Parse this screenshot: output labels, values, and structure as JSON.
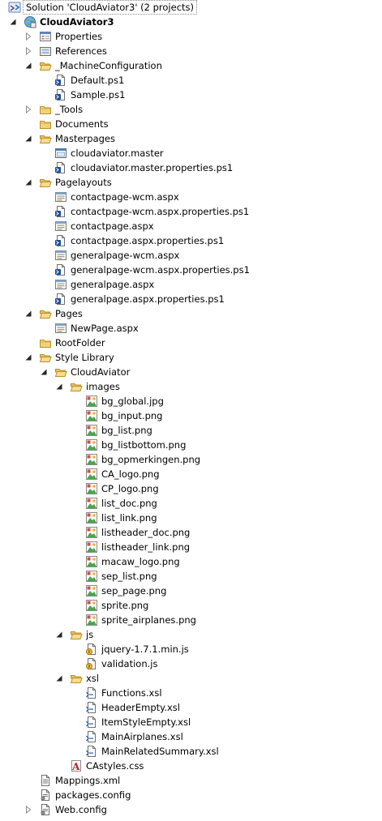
{
  "tree": [
    {
      "label": "Solution 'CloudAviator3' (2 projects)",
      "depth": 0,
      "icon": "solution-icon",
      "exp": "none",
      "selected": true
    },
    {
      "label": "CloudAviator3",
      "depth": 0,
      "icon": "web-project-icon",
      "exp": "open",
      "bold": true
    },
    {
      "label": "Properties",
      "depth": 1,
      "icon": "properties-icon",
      "exp": "closed"
    },
    {
      "label": "References",
      "depth": 1,
      "icon": "references-icon",
      "exp": "closed"
    },
    {
      "label": "_MachineConfiguration",
      "depth": 1,
      "icon": "folder-open-icon",
      "exp": "open"
    },
    {
      "label": "Default.ps1",
      "depth": 2,
      "icon": "script-file-icon",
      "exp": "none"
    },
    {
      "label": "Sample.ps1",
      "depth": 2,
      "icon": "script-file-icon",
      "exp": "none"
    },
    {
      "label": "_Tools",
      "depth": 1,
      "icon": "folder-icon",
      "exp": "closed"
    },
    {
      "label": "Documents",
      "depth": 1,
      "icon": "folder-icon",
      "exp": "none"
    },
    {
      "label": "Masterpages",
      "depth": 1,
      "icon": "folder-open-icon",
      "exp": "open"
    },
    {
      "label": "cloudaviator.master",
      "depth": 2,
      "icon": "master-page-icon",
      "exp": "none"
    },
    {
      "label": "cloudaviator.master.properties.ps1",
      "depth": 2,
      "icon": "script-file-icon",
      "exp": "none"
    },
    {
      "label": "Pagelayouts",
      "depth": 1,
      "icon": "folder-open-icon",
      "exp": "open"
    },
    {
      "label": "contactpage-wcm.aspx",
      "depth": 2,
      "icon": "aspx-file-icon",
      "exp": "none"
    },
    {
      "label": "contactpage-wcm.aspx.properties.ps1",
      "depth": 2,
      "icon": "script-file-icon",
      "exp": "none"
    },
    {
      "label": "contactpage.aspx",
      "depth": 2,
      "icon": "aspx-file-icon",
      "exp": "none"
    },
    {
      "label": "contactpage.aspx.properties.ps1",
      "depth": 2,
      "icon": "script-file-icon",
      "exp": "none"
    },
    {
      "label": "generalpage-wcm.aspx",
      "depth": 2,
      "icon": "aspx-file-icon",
      "exp": "none"
    },
    {
      "label": "generalpage-wcm.aspx.properties.ps1",
      "depth": 2,
      "icon": "script-file-icon",
      "exp": "none"
    },
    {
      "label": "generalpage.aspx",
      "depth": 2,
      "icon": "aspx-file-icon",
      "exp": "none"
    },
    {
      "label": "generalpage.aspx.properties.ps1",
      "depth": 2,
      "icon": "script-file-icon",
      "exp": "none"
    },
    {
      "label": "Pages",
      "depth": 1,
      "icon": "folder-open-icon",
      "exp": "open"
    },
    {
      "label": "NewPage.aspx",
      "depth": 2,
      "icon": "aspx-file-icon",
      "exp": "none"
    },
    {
      "label": "RootFolder",
      "depth": 1,
      "icon": "folder-icon",
      "exp": "none"
    },
    {
      "label": "Style Library",
      "depth": 1,
      "icon": "folder-open-icon",
      "exp": "open"
    },
    {
      "label": "CloudAviator",
      "depth": 2,
      "icon": "folder-open-icon",
      "exp": "open"
    },
    {
      "label": "images",
      "depth": 3,
      "icon": "folder-open-icon",
      "exp": "open"
    },
    {
      "label": "bg_global.jpg",
      "depth": 4,
      "icon": "image-file-icon",
      "exp": "none"
    },
    {
      "label": "bg_input.png",
      "depth": 4,
      "icon": "image-file-icon",
      "exp": "none"
    },
    {
      "label": "bg_list.png",
      "depth": 4,
      "icon": "image-file-icon",
      "exp": "none"
    },
    {
      "label": "bg_listbottom.png",
      "depth": 4,
      "icon": "image-file-icon",
      "exp": "none"
    },
    {
      "label": "bg_opmerkingen.png",
      "depth": 4,
      "icon": "image-file-icon",
      "exp": "none"
    },
    {
      "label": "CA_logo.png",
      "depth": 4,
      "icon": "image-file-icon",
      "exp": "none"
    },
    {
      "label": "CP_logo.png",
      "depth": 4,
      "icon": "image-file-icon",
      "exp": "none"
    },
    {
      "label": "list_doc.png",
      "depth": 4,
      "icon": "image-file-icon",
      "exp": "none"
    },
    {
      "label": "list_link.png",
      "depth": 4,
      "icon": "image-file-icon",
      "exp": "none"
    },
    {
      "label": "listheader_doc.png",
      "depth": 4,
      "icon": "image-file-icon",
      "exp": "none"
    },
    {
      "label": "listheader_link.png",
      "depth": 4,
      "icon": "image-file-icon",
      "exp": "none"
    },
    {
      "label": "macaw_logo.png",
      "depth": 4,
      "icon": "image-file-icon",
      "exp": "none"
    },
    {
      "label": "sep_list.png",
      "depth": 4,
      "icon": "image-file-icon",
      "exp": "none"
    },
    {
      "label": "sep_page.png",
      "depth": 4,
      "icon": "image-file-icon",
      "exp": "none"
    },
    {
      "label": "sprite.png",
      "depth": 4,
      "icon": "image-file-icon",
      "exp": "none"
    },
    {
      "label": "sprite_airplanes.png",
      "depth": 4,
      "icon": "image-file-icon",
      "exp": "none"
    },
    {
      "label": "js",
      "depth": 3,
      "icon": "folder-open-icon",
      "exp": "open"
    },
    {
      "label": "jquery-1.7.1.min.js",
      "depth": 4,
      "icon": "js-file-icon",
      "exp": "none"
    },
    {
      "label": "validation.js",
      "depth": 4,
      "icon": "js-file-icon",
      "exp": "none"
    },
    {
      "label": "xsl",
      "depth": 3,
      "icon": "folder-open-icon",
      "exp": "open"
    },
    {
      "label": "Functions.xsl",
      "depth": 4,
      "icon": "xsl-file-icon",
      "exp": "none"
    },
    {
      "label": "HeaderEmpty.xsl",
      "depth": 4,
      "icon": "xsl-file-icon",
      "exp": "none"
    },
    {
      "label": "ItemStyleEmpty.xsl",
      "depth": 4,
      "icon": "xsl-file-icon",
      "exp": "none"
    },
    {
      "label": "MainAirplanes.xsl",
      "depth": 4,
      "icon": "xsl-file-icon",
      "exp": "none"
    },
    {
      "label": "MainRelatedSummary.xsl",
      "depth": 4,
      "icon": "xsl-file-icon",
      "exp": "none"
    },
    {
      "label": "CAstyles.css",
      "depth": 3,
      "icon": "css-file-icon",
      "exp": "none"
    },
    {
      "label": "Mappings.xml",
      "depth": 1,
      "icon": "xml-file-icon",
      "exp": "none"
    },
    {
      "label": "packages.config",
      "depth": 1,
      "icon": "config-file-icon",
      "exp": "none"
    },
    {
      "label": "Web.config",
      "depth": 1,
      "icon": "config-file-icon",
      "exp": "closed"
    }
  ]
}
